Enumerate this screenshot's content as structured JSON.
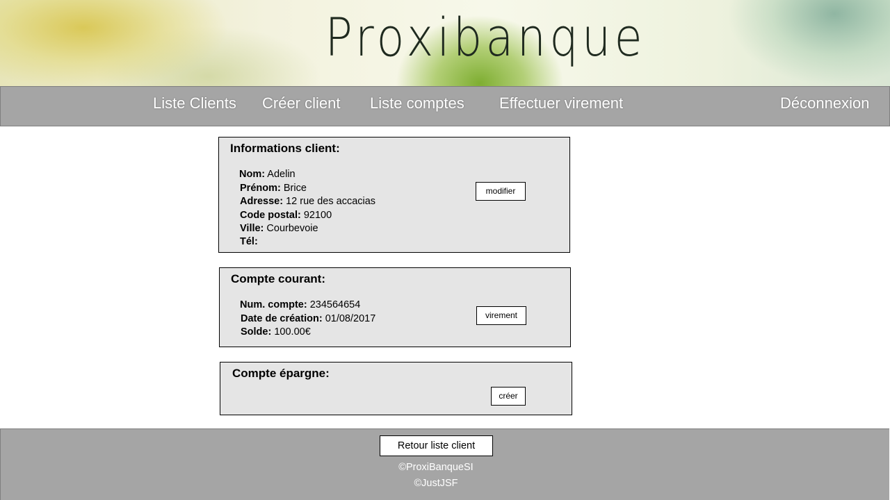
{
  "header": {
    "brand": "Proxibanque"
  },
  "nav": {
    "items": [
      "Liste Clients",
      "Créer client",
      "Liste comptes",
      "Effectuer virement"
    ],
    "logout": "Déconnexion"
  },
  "client": {
    "title": "Informations client:",
    "fields": [
      {
        "label": "Nom:",
        "value": "Adelin"
      },
      {
        "label": "Prénom:",
        "value": "Brice"
      },
      {
        "label": "Adresse:",
        "value": "12 rue des accacias"
      },
      {
        "label": "Code postal:",
        "value": "92100"
      },
      {
        "label": "Ville:",
        "value": "Courbevoie"
      },
      {
        "label": "Tél:",
        "value": ""
      }
    ],
    "button": "modifier"
  },
  "compte_courant": {
    "title": "Compte courant:",
    "fields": [
      {
        "label": "Num. compte:",
        "value": "234564654"
      },
      {
        "label": "Date de création:",
        "value": "01/08/2017"
      },
      {
        "label": "Solde:",
        "value": "100.00€"
      }
    ],
    "button": "virement"
  },
  "compte_epargne": {
    "title": "Compte épargne:",
    "button": "créer"
  },
  "footer": {
    "back_button": "Retour liste client",
    "copyright_1": "©ProxiBanqueSI",
    "copyright_2": "©JustJSF"
  }
}
